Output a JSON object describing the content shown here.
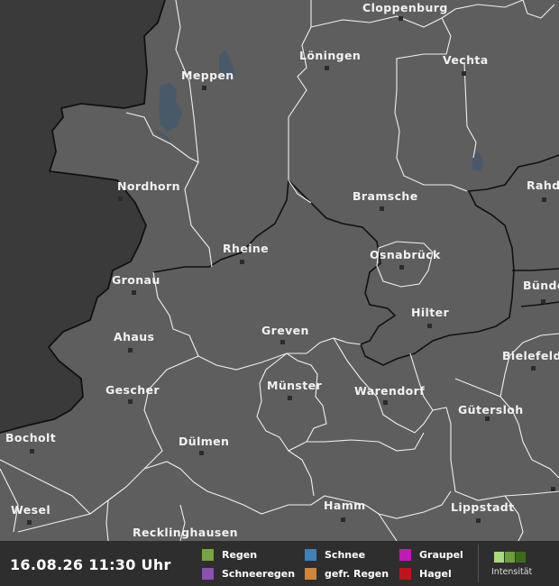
{
  "map": {
    "land_color": "#5e5e5e",
    "outside_color": "#3a3a3a",
    "water_color": "#48596a",
    "cities": [
      {
        "id": "cloppenburg",
        "name": "Cloppenburg"
      },
      {
        "id": "loningen",
        "name": "Löningen"
      },
      {
        "id": "meppen",
        "name": "Meppen"
      },
      {
        "id": "vechta",
        "name": "Vechta"
      },
      {
        "id": "nordhorn",
        "name": "Nordhorn"
      },
      {
        "id": "bramsche",
        "name": "Bramsche"
      },
      {
        "id": "rahden",
        "name": "Rahde"
      },
      {
        "id": "rheine",
        "name": "Rheine"
      },
      {
        "id": "osnabruck",
        "name": "Osnabrück"
      },
      {
        "id": "gronau",
        "name": "Gronau"
      },
      {
        "id": "bunde",
        "name": "Bünde"
      },
      {
        "id": "hilter",
        "name": "Hilter"
      },
      {
        "id": "ahaus",
        "name": "Ahaus"
      },
      {
        "id": "greven",
        "name": "Greven"
      },
      {
        "id": "bielefeld",
        "name": "Bielefeld"
      },
      {
        "id": "gescher",
        "name": "Gescher"
      },
      {
        "id": "munster",
        "name": "Münster"
      },
      {
        "id": "warendorf",
        "name": "Warendorf"
      },
      {
        "id": "gutersloh",
        "name": "Gütersloh"
      },
      {
        "id": "bocholt",
        "name": "Bocholt"
      },
      {
        "id": "dulmen",
        "name": "Dülmen"
      },
      {
        "id": "wesel",
        "name": "Wesel"
      },
      {
        "id": "hamm",
        "name": "Hamm"
      },
      {
        "id": "lippstadt",
        "name": "Lippstadt"
      },
      {
        "id": "recklinghausen",
        "name": "Recklinghausen"
      }
    ]
  },
  "legend": {
    "timestamp": "16.08.26 11:30 Uhr",
    "items": [
      {
        "id": "regen",
        "label": "Regen",
        "color": "#76a63e"
      },
      {
        "id": "schneeregen",
        "label": "Schneeregen",
        "color": "#8e4fb3"
      },
      {
        "id": "schnee",
        "label": "Schnee",
        "color": "#3f82b8"
      },
      {
        "id": "gefr-regen",
        "label": "gefr. Regen",
        "color": "#d0843c"
      },
      {
        "id": "graupel",
        "label": "Graupel",
        "color": "#c21bb4"
      },
      {
        "id": "hagel",
        "label": "Hagel",
        "color": "#c4121c"
      }
    ],
    "intensity_label": "Intensität",
    "intensity_colors": [
      "#a9d97a",
      "#6f9e3b",
      "#3d6b1e"
    ]
  }
}
